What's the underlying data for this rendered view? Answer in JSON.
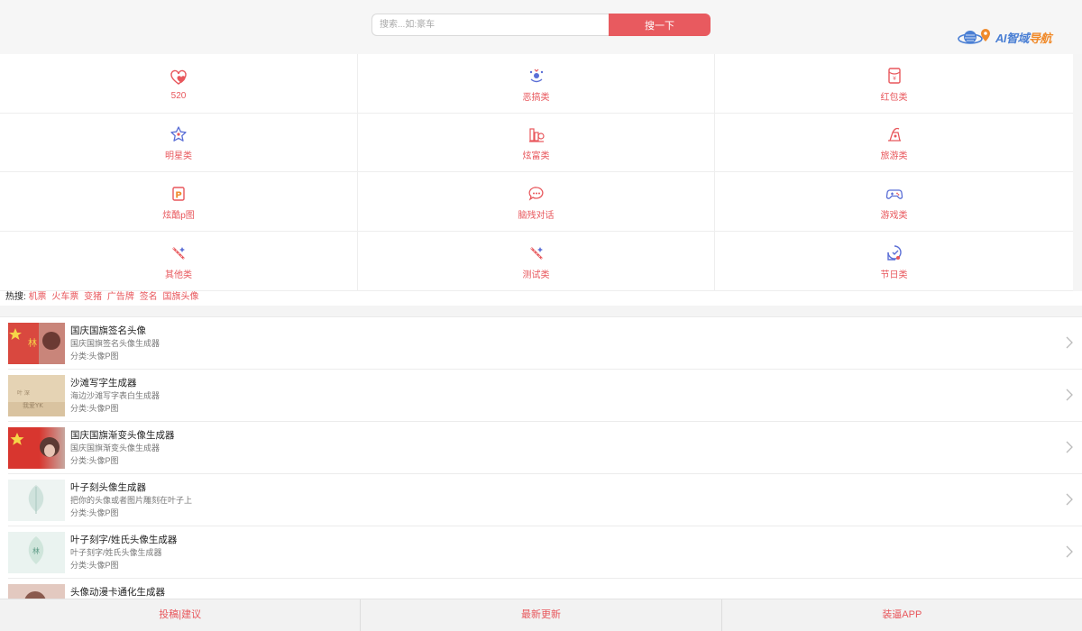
{
  "search": {
    "placeholder": "搜索...如:豪车",
    "button_label": "搜一下"
  },
  "logo": {
    "text_ai": "AI",
    "text_main": "智域",
    "text_hl": "导航"
  },
  "categories": [
    {
      "label": "520",
      "icon": "heart-icon"
    },
    {
      "label": "恶搞类",
      "icon": "clown-face-icon"
    },
    {
      "label": "红包类",
      "icon": "red-envelope-icon"
    },
    {
      "label": "明星类",
      "icon": "star-icon"
    },
    {
      "label": "炫富类",
      "icon": "money-stack-icon"
    },
    {
      "label": "旅游类",
      "icon": "travel-icon"
    },
    {
      "label": "炫酷p图",
      "icon": "p-badge-icon"
    },
    {
      "label": "脑残对话",
      "icon": "chat-bubble-icon"
    },
    {
      "label": "游戏类",
      "icon": "gamepad-icon"
    },
    {
      "label": "其他类",
      "icon": "magic-wand-icon"
    },
    {
      "label": "测试类",
      "icon": "magic-wand-icon"
    },
    {
      "label": "节日类",
      "icon": "festival-icon"
    }
  ],
  "hot_search": {
    "title": "热搜:",
    "links": [
      "机票",
      "火车票",
      "变猪",
      "广告牌",
      "签名",
      "国旗头像"
    ]
  },
  "list": [
    {
      "title": "国庆国旗签名头像",
      "desc": "国庆国旗签名头像生成器",
      "category": "分类:头像P图",
      "thumb": "flag-portrait-thumbnail"
    },
    {
      "title": "沙滩写字生成器",
      "desc": "海边沙滩写字表白生成器",
      "category": "分类:头像P图",
      "thumb": "sand-writing-thumbnail"
    },
    {
      "title": "国庆国旗渐变头像生成器",
      "desc": "国庆国旗渐变头像生成器",
      "category": "分类:头像P图",
      "thumb": "flag-gradient-thumbnail"
    },
    {
      "title": "叶子刻头像生成器",
      "desc": "把你的头像或者图片雕刻在叶子上",
      "category": "分类:头像P图",
      "thumb": "leaf-carving-thumbnail"
    },
    {
      "title": "叶子刻字/姓氏头像生成器",
      "desc": "叶子刻字/姓氏头像生成器",
      "category": "分类:头像P图",
      "thumb": "leaf-name-thumbnail"
    },
    {
      "title": "头像动漫卡通化生成器",
      "desc": "",
      "category": "",
      "thumb": "anime-portrait-thumbnail"
    }
  ],
  "bottom_bar": {
    "links": [
      "投稿|建议",
      "最新更新",
      "装逼APP"
    ]
  },
  "colors": {
    "accent": "#e85a5f",
    "label_red": "#e8575c",
    "icon_blue": "#5b6fd6"
  }
}
